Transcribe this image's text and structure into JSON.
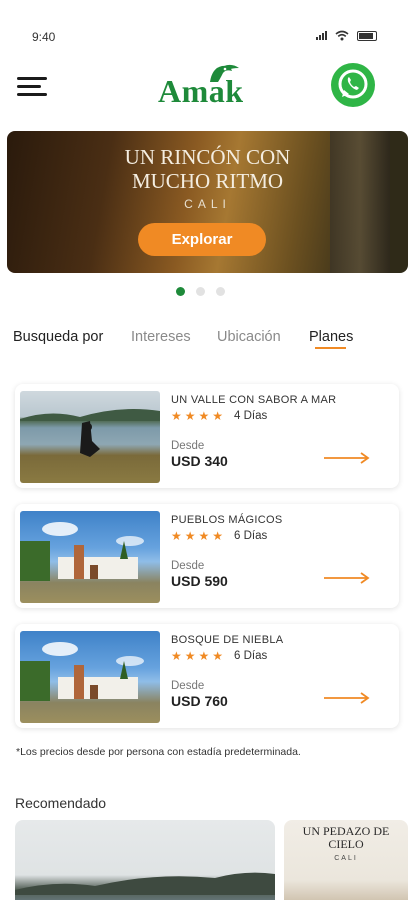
{
  "status_bar": {
    "time": "9:40"
  },
  "header": {
    "logo_text": "Amak",
    "menu_icon": "hamburger-icon",
    "chat_icon": "whatsapp-icon"
  },
  "hero": {
    "title_line1": "UN RINCÓN CON",
    "title_line2": "MUCHO RITMO",
    "subtitle": "CALI",
    "button_label": "Explorar",
    "carousel_pages": 3,
    "active_page": 1
  },
  "tabs": {
    "lead": "Busqueda por",
    "items": [
      "Intereses",
      "Ubicación",
      "Planes"
    ],
    "active": "Planes"
  },
  "plans": [
    {
      "title": "UN VALLE CON SABOR A MAR",
      "stars": "★★★★",
      "rating": 4,
      "days": "4 Días",
      "from_label": "Desde",
      "price": "USD 340"
    },
    {
      "title": "PUEBLOS MÁGICOS",
      "stars": "★★★★",
      "rating": 4,
      "days": "6 Días",
      "from_label": "Desde",
      "price": "USD 590"
    },
    {
      "title": "BOSQUE DE NIEBLA",
      "stars": "★★★★",
      "rating": 4,
      "days": "6 Días",
      "from_label": "Desde",
      "price": "USD 760"
    }
  ],
  "footnote": "*Los precios desde por persona con estadía predeterminada.",
  "recommended": {
    "title": "Recomendado",
    "card2_title_line1": "UN PEDAZO DE",
    "card2_title_line2": "CIELO",
    "card2_subtitle": "CALI"
  },
  "colors": {
    "brand_green": "#1e8a3a",
    "accent_orange": "#f08a24",
    "whatsapp_green": "#2fb546"
  }
}
